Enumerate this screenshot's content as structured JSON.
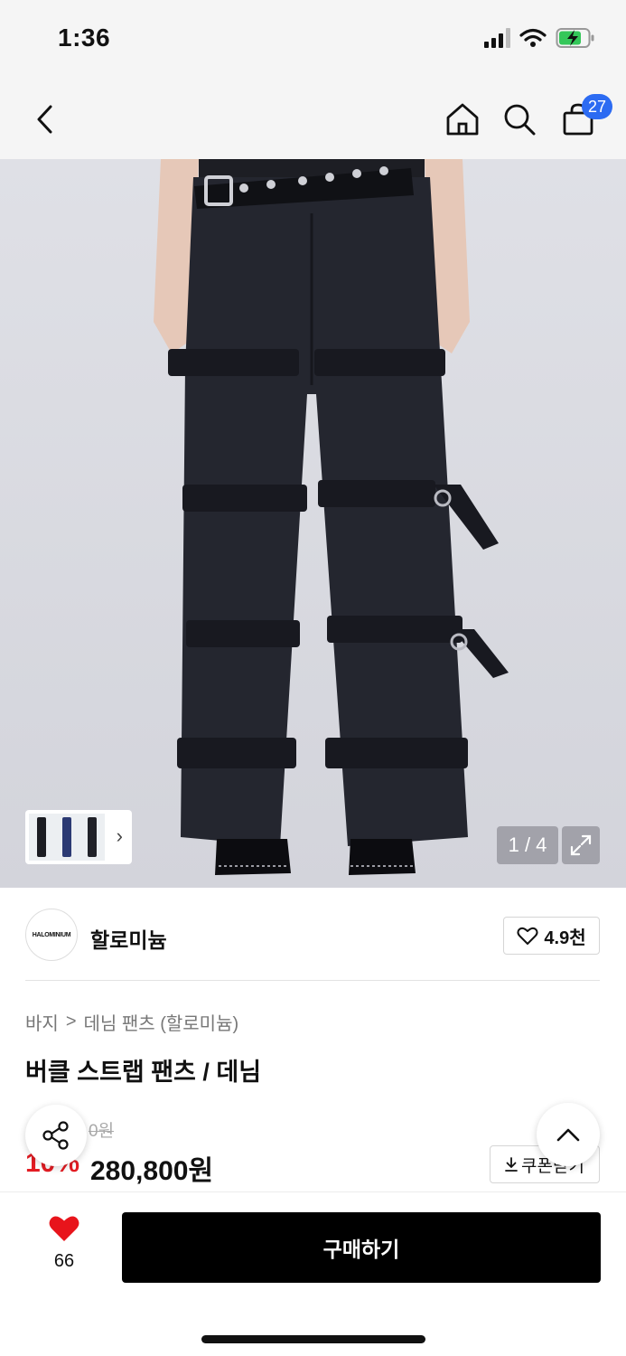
{
  "status_bar": {
    "time": "1:36"
  },
  "nav": {
    "cart_count": "27"
  },
  "gallery": {
    "counter": "1 / 4",
    "thumb_arrow": "›"
  },
  "brand": {
    "logo_text": "HALOMINIUM",
    "name": "할로미늄",
    "likes": "4.9천"
  },
  "breadcrumb": {
    "category": "바지",
    "separator": ">",
    "subcategory": "데님 팬츠 (할로미늄)"
  },
  "product": {
    "title": "버클 스트랩 팬츠 / 데님",
    "original_price": "0원",
    "discount": "10%",
    "price": "280,800원",
    "coupon_label": "쿠폰받기"
  },
  "bottom": {
    "wish_count": "66",
    "buy_label": "구매하기"
  },
  "colors": {
    "accent_blue": "#2c6bf2",
    "discount_red": "#e31c23",
    "heart_red": "#e8141b",
    "buy_button": "#000000"
  }
}
